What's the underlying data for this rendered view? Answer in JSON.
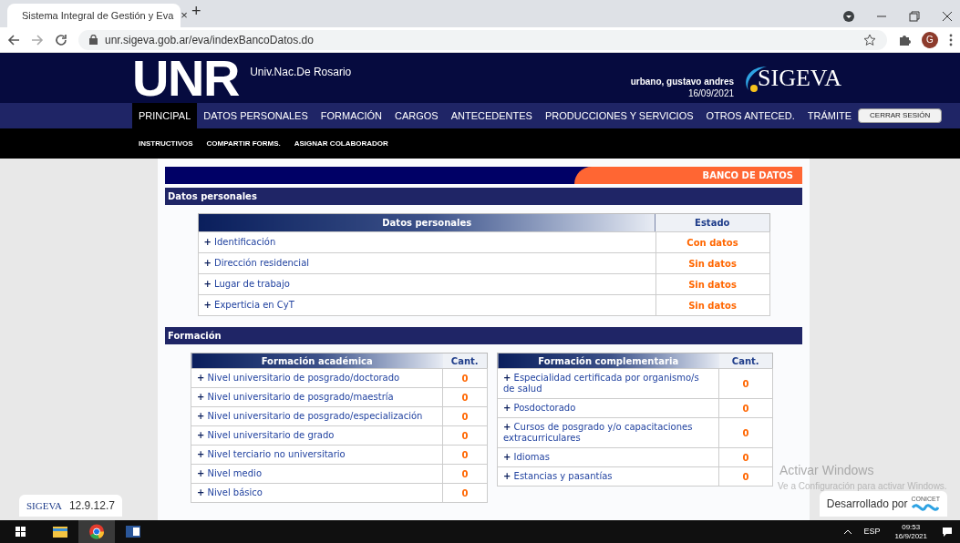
{
  "browser": {
    "tab_title": "Sistema Integral de Gestión y Eva",
    "tab_close": "×",
    "new_tab": "+",
    "url": "unr.sigeva.gob.ar/eva/indexBancoDatos.do",
    "profile": "G"
  },
  "header": {
    "logo": "UNR",
    "subtitle": "Univ.Nac.De Rosario",
    "user": "urbano, gustavo andres",
    "date": "16/09/2021",
    "brand": "SIGEVA"
  },
  "nav": {
    "items": [
      {
        "label": "PRINCIPAL",
        "selected": true
      },
      {
        "label": "DATOS PERSONALES",
        "selected": false
      },
      {
        "label": "FORMACIÓN",
        "selected": false
      },
      {
        "label": "CARGOS",
        "selected": false
      },
      {
        "label": "ANTECEDENTES",
        "selected": false
      },
      {
        "label": "PRODUCCIONES Y SERVICIOS",
        "selected": false
      },
      {
        "label": "OTROS ANTECED.",
        "selected": false
      },
      {
        "label": "TRÁMITE",
        "selected": false
      }
    ],
    "logout": "CERRAR SESIÓN"
  },
  "subnav": [
    "INSTRUCTIVOS",
    "COMPARTIR FORMS.",
    "ASIGNAR COLABORADOR"
  ],
  "banner": "BANCO DE DATOS",
  "personal": {
    "title": "Datos personales",
    "marker": "+",
    "columns": [
      "Datos personales",
      "Estado"
    ],
    "rows": [
      {
        "label": "Identificación",
        "status": "Con datos"
      },
      {
        "label": "Dirección residencial",
        "status": "Sin datos"
      },
      {
        "label": "Lugar de trabajo",
        "status": "Sin datos"
      },
      {
        "label": "Experticia en CyT",
        "status": "Sin datos"
      }
    ]
  },
  "formacion": {
    "title": "Formación",
    "tables": [
      {
        "marker": "+",
        "columns": [
          "Formación académica",
          "Cant."
        ],
        "rows": [
          {
            "label": "Nivel universitario de posgrado/doctorado",
            "count": "0"
          },
          {
            "label": "Nivel universitario de posgrado/maestría",
            "count": "0"
          },
          {
            "label": "Nivel universitario de posgrado/especialización",
            "count": "0"
          },
          {
            "label": "Nivel universitario de grado",
            "count": "0"
          },
          {
            "label": "Nivel terciario no universitario",
            "count": "0"
          },
          {
            "label": "Nivel medio",
            "count": "0"
          },
          {
            "label": "Nivel básico",
            "count": "0"
          }
        ]
      },
      {
        "marker": "+",
        "columns": [
          "Formación complementaria",
          "Cant."
        ],
        "rows": [
          {
            "label": "Especialidad certificada por organismo/s de salud",
            "count": "0"
          },
          {
            "label": "Posdoctorado",
            "count": "0"
          },
          {
            "label": "Cursos de posgrado y/o capacitaciones extracurriculares",
            "count": "0"
          },
          {
            "label": "Idiomas",
            "count": "0"
          },
          {
            "label": "Estancias y pasantías",
            "count": "0"
          }
        ]
      }
    ]
  },
  "footer": {
    "brand": "SIGEVA",
    "version": "12.9.12.7",
    "developed_by": "Desarrollado por",
    "partner": "CONICET"
  },
  "windows_notice": {
    "title": "Activar Windows",
    "text": "Ve a Configuración para activar Windows."
  },
  "taskbar": {
    "language": "ESP",
    "time": "09:53",
    "date": "16/9/2021"
  }
}
